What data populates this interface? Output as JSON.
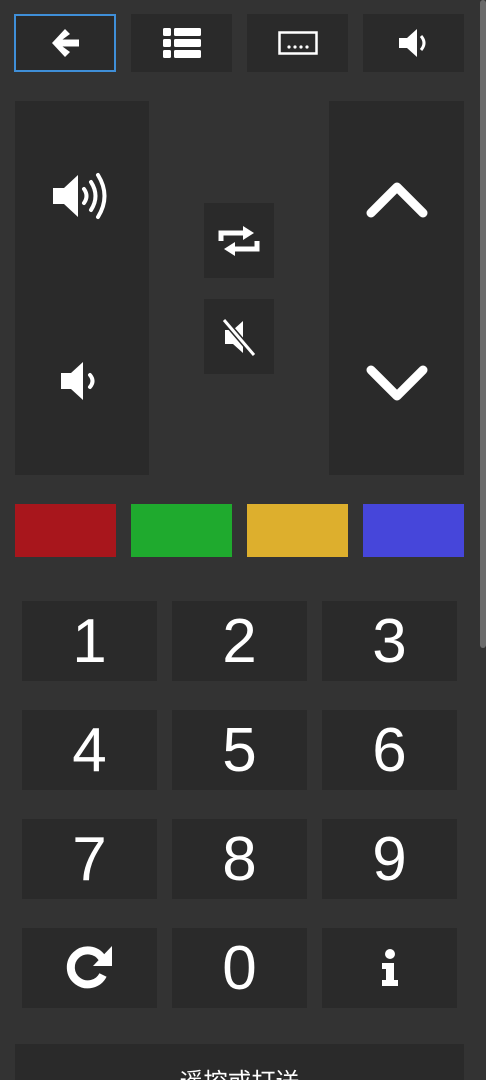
{
  "top_row": {
    "back_icon": "arrow-left-icon",
    "list_icon": "list-icon",
    "subtitles_icon": "subtitles-icon",
    "audio_track_icon": "speaker-icon"
  },
  "volume": {
    "up_icon": "volume-up-icon",
    "down_icon": "volume-down-icon"
  },
  "center": {
    "repeat_icon": "repeat-icon",
    "mute_icon": "mute-icon"
  },
  "channel": {
    "up_icon": "chevron-up-icon",
    "down_icon": "chevron-down-icon"
  },
  "color_keys": {
    "red": "#a8161c",
    "green": "#1faa2e",
    "yellow": "#ddaf2d",
    "blue": "#4646da"
  },
  "numpad": {
    "k1": "1",
    "k2": "2",
    "k3": "3",
    "k4": "4",
    "k5": "5",
    "k6": "6",
    "k7": "7",
    "k8": "8",
    "k9": "9",
    "k0": "0",
    "refresh_icon": "refresh-icon",
    "info_icon": "info-icon"
  },
  "bottom_bar": {
    "label": "遥控或打送"
  },
  "colors": {
    "background": "#333333",
    "button": "#2a2a2a",
    "focus_border": "#3f8fd8",
    "icon": "#ffffff"
  }
}
